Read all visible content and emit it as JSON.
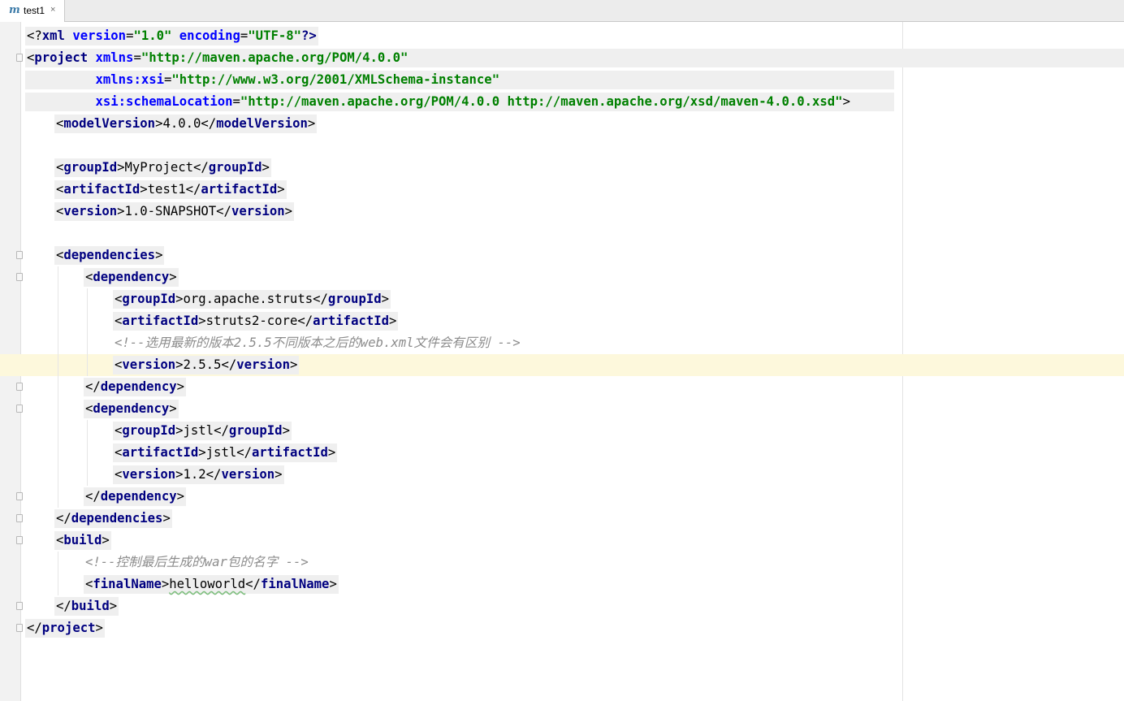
{
  "tab": {
    "icon": "maven-m-icon",
    "label": "test1",
    "close": "×"
  },
  "editor": {
    "lines": [
      {
        "indent": 0,
        "pre": "<?",
        "name": "xml",
        "attrs": [
          {
            "sep": " ",
            "name": "version",
            "eq": "=",
            "value": "\"1.0\""
          },
          {
            "sep": " ",
            "name": "encoding",
            "eq": "=",
            "value": "\"UTF-8\""
          }
        ],
        "post": "?>"
      },
      {
        "indent": 0,
        "pre": "<",
        "name": "project",
        "attrs": [
          {
            "sep": " ",
            "name": "xmlns",
            "eq": "=",
            "value": "\"http://maven.apache.org/POM/4.0.0\""
          }
        ]
      },
      {
        "indent": 0,
        "attrs": [
          {
            "sep": "         ",
            "name": "xmlns:xsi",
            "eq": "=",
            "value": "\"http://www.w3.org/2001/XMLSchema-instance\""
          }
        ]
      },
      {
        "indent": 0,
        "attrs": [
          {
            "sep": "         ",
            "name": "xsi:schemaLocation",
            "eq": "=",
            "value": "\"http://maven.apache.org/POM/4.0.0 http://maven.apache.org/xsd/maven-4.0.0.xsd\""
          }
        ],
        "post": ">"
      },
      {
        "indent": 1,
        "pre": "<",
        "name": "modelVersion",
        "mid": ">",
        "text": "4.0.0",
        "close": "</",
        "closeName": "modelVersion",
        "post": ">"
      },
      {
        "indent": 0
      },
      {
        "indent": 1,
        "pre": "<",
        "name": "groupId",
        "mid": ">",
        "text": "MyProject",
        "close": "</",
        "closeName": "groupId",
        "post": ">"
      },
      {
        "indent": 1,
        "pre": "<",
        "name": "artifactId",
        "mid": ">",
        "text": "test1",
        "close": "</",
        "closeName": "artifactId",
        "post": ">"
      },
      {
        "indent": 1,
        "pre": "<",
        "name": "version",
        "mid": ">",
        "text": "1.0-SNAPSHOT",
        "close": "</",
        "closeName": "version",
        "post": ">"
      },
      {
        "indent": 0
      },
      {
        "indent": 1,
        "pre": "<",
        "name": "dependencies",
        "post": ">"
      },
      {
        "indent": 2,
        "pre": "<",
        "name": "dependency",
        "post": ">"
      },
      {
        "indent": 3,
        "pre": "<",
        "name": "groupId",
        "mid": ">",
        "text": "org.apache.struts",
        "close": "</",
        "closeName": "groupId",
        "post": ">"
      },
      {
        "indent": 3,
        "pre": "<",
        "name": "artifactId",
        "mid": ">",
        "text": "struts2-core",
        "close": "</",
        "closeName": "artifactId",
        "post": ">"
      },
      {
        "indent": 3,
        "comment": "<!--选用最新的版本2.5.5不同版本之后的web.xml文件会有区别 -->"
      },
      {
        "indent": 3,
        "pre": "<",
        "name": "version",
        "mid": ">",
        "text": "2.5.5",
        "close": "</",
        "closeName": "version",
        "post": ">"
      },
      {
        "indent": 2,
        "pre": "</",
        "name": "dependency",
        "post": ">"
      },
      {
        "indent": 2,
        "pre": "<",
        "name": "dependency",
        "post": ">"
      },
      {
        "indent": 3,
        "pre": "<",
        "name": "groupId",
        "mid": ">",
        "text": "jstl",
        "close": "</",
        "closeName": "groupId",
        "post": ">"
      },
      {
        "indent": 3,
        "pre": "<",
        "name": "artifactId",
        "mid": ">",
        "text": "jstl",
        "close": "</",
        "closeName": "artifactId",
        "post": ">"
      },
      {
        "indent": 3,
        "pre": "<",
        "name": "version",
        "mid": ">",
        "text": "1.2",
        "close": "</",
        "closeName": "version",
        "post": ">"
      },
      {
        "indent": 2,
        "pre": "</",
        "name": "dependency",
        "post": ">"
      },
      {
        "indent": 1,
        "pre": "</",
        "name": "dependencies",
        "post": ">"
      },
      {
        "indent": 1,
        "pre": "<",
        "name": "build",
        "post": ">"
      },
      {
        "indent": 2,
        "comment": "<!--控制最后生成的war包的名字 -->"
      },
      {
        "indent": 2,
        "pre": "<",
        "name": "finalName",
        "mid": ">",
        "text": "helloworld",
        "close": "</",
        "closeName": "finalName",
        "post": ">"
      },
      {
        "indent": 1,
        "pre": "</",
        "name": "build",
        "post": ">"
      },
      {
        "indent": 0,
        "pre": "</",
        "name": "project",
        "post": ">"
      }
    ]
  }
}
